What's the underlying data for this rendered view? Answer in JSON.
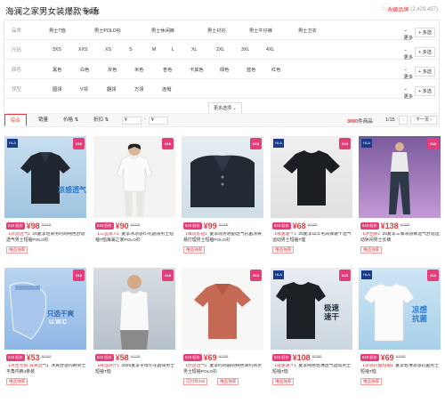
{
  "header": {
    "title": "海澜之家男女装爆款专场",
    "discount_num": "4",
    "discount_text": "折起",
    "fav_label": "收藏品牌",
    "fav_count": "(2,429,457)"
  },
  "filters": [
    {
      "label": "品类",
      "values": [
        "男士T恤",
        "男士POLO衫",
        "男士休闲裤",
        "男士衬衫",
        "男士牛仔裤",
        "男士卫衣"
      ],
      "more": "更多",
      "multi": "+ 多选"
    },
    {
      "label": "尺码",
      "values": [
        "3XS",
        "XXS",
        "XS",
        "S",
        "M",
        "L",
        "XL",
        "2XL",
        "3XL",
        "4XL"
      ],
      "more": "更多",
      "multi": "+ 多选"
    },
    {
      "label": "颜色",
      "values": [
        "黑色",
        "白色",
        "灰色",
        "米色",
        "杏色",
        "卡其色",
        "绿色",
        "蓝色",
        "红色"
      ],
      "more": "更多",
      "multi": "+ 多选"
    },
    {
      "label": "领型",
      "values": [
        "圆领",
        "V领",
        "翻领",
        "方领",
        "连帽"
      ],
      "more": "更多",
      "multi": "+ 多选"
    }
  ],
  "expand_label": "更多选项 ⌄",
  "sortbar": {
    "tabs": [
      "综合",
      "销量",
      "价格 ⇅",
      "折扣 ⇅"
    ],
    "price_from": "¥",
    "price_dash": "-",
    "price_to": "¥",
    "count": "3000",
    "count_suffix": "件商品",
    "page": "1/15",
    "prev": "‹",
    "next": "下一页 ›"
  },
  "colors": {
    "accent": "#e4393c",
    "tag": "#e63c7a"
  },
  "products": [
    {
      "tag": "618",
      "sub": "低价",
      "price": "¥98",
      "orig": "¥229",
      "hl": "【凉感透气】",
      "desc": "25夏季轻商务时尚纯色舒适透气男士短袖POLO衫",
      "shop": "唯品独家",
      "icon": "dark-polo"
    },
    {
      "tag": "618",
      "sub": "低价",
      "price": "¥90",
      "orig": "¥158",
      "hl": "【三国演义】",
      "desc": "夏季冰凉感印花圆领男士短袖T恤海澜之家POLO衫",
      "shop": "",
      "icon": "white-polo"
    },
    {
      "tag": "618",
      "sub": "低价",
      "price": "¥99",
      "orig": "¥198",
      "hl": "【每周必抢】",
      "desc": "夏季商务通勤透气抗菌凉爽易打理男士短袖POLO衫",
      "shop": "唯品独家",
      "icon": "black-polo"
    },
    {
      "tag": "618",
      "sub": "低价",
      "price": "¥68",
      "orig": "¥198",
      "hl": "【极速速干】",
      "desc": "25夏季山羊毛高弹速干透气运动男士短袖T恤",
      "shop": "唯品独家",
      "icon": "black-tshirt"
    },
    {
      "tag": "618",
      "sub": "低价",
      "price": "¥138",
      "orig": "¥298",
      "hl": "【冰丝裤】",
      "desc": "25夏季三弹凉感裤透气舒适运动休闲男士长裤",
      "shop": "唯品独家",
      "icon": "pants"
    },
    {
      "tag": "618",
      "sub": "低价",
      "price": "¥53",
      "orig": "¥159",
      "hl": "【冰丝无痕 清爽透气】",
      "desc": "冰爽舒适内裤男士平角内裤4条装",
      "shop": "唯品独家",
      "icon": "underwear"
    },
    {
      "tag": "618",
      "sub": "低价",
      "price": "¥58",
      "orig": "¥128",
      "hl": "【吸湿排汗】",
      "desc": "2025夏季字母印花圆领男士短袖T恤",
      "shop": "",
      "icon": "white-tank"
    },
    {
      "tag": "618",
      "sub": "低价",
      "price": "¥69",
      "orig": "¥198",
      "hl": "【舒适透气】",
      "desc": "夏季时尚翻领纯色简约商务男士短袖POLO衫",
      "shop": "已付款490",
      "shop2": "唯品独家",
      "icon": "rust-polo"
    },
    {
      "tag": "618",
      "sub": "低价",
      "price": "¥108",
      "orig": "¥198",
      "hl": "【极速速干】",
      "desc": "夏季纯色轻薄透气运动男士短袖T恤",
      "shop": "唯品独家",
      "icon": "black-quickdry"
    },
    {
      "tag": "618",
      "sub": "低价",
      "price": "¥69",
      "orig": "¥198",
      "hl": "【凉感抗菌短袖】",
      "desc": "夏季轻薄凉感抗菌男士短袖T恤",
      "shop": "唯品独家",
      "icon": "white-cool"
    }
  ],
  "overlay": {
    "p0": "凉感透气",
    "p5a": "只选干爽",
    "p5b": "U.W.C",
    "p8": "极速速干",
    "p9": "凉感抗菌"
  }
}
